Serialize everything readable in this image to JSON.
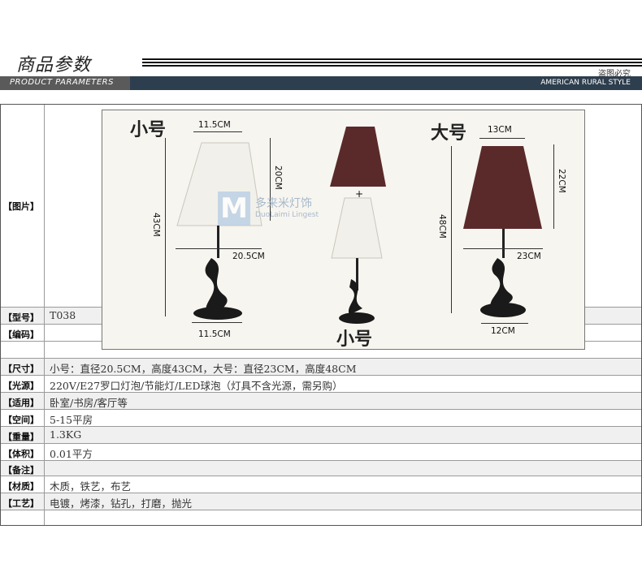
{
  "header": {
    "title": "商品参数",
    "subtitle": "PRODUCT PARAMETERS",
    "right_top": "盗图必究",
    "right_bottom": "AMERICAN RURAL STYLE"
  },
  "photo": {
    "label_small_left": "小号",
    "label_large": "大号",
    "label_small_bottom": "小号",
    "plus": "+",
    "watermark_cn": "多来米灯饰",
    "watermark_en": "DuoLaimi Lingest",
    "watermark_logo": "M",
    "small_lamp": {
      "top_width": "11.5CM",
      "shade_height": "20CM",
      "total_height": "43CM",
      "shade_diameter": "20.5CM",
      "base_width": "11.5CM"
    },
    "large_lamp": {
      "top_width": "13CM",
      "shade_height": "22CM",
      "total_height": "48CM",
      "shade_diameter": "23CM",
      "base_width": "12CM"
    }
  },
  "rows": [
    {
      "label": "【图片】",
      "value": ""
    },
    {
      "label": "【型号】",
      "value": "T038"
    },
    {
      "label": "【编码】",
      "value": ""
    },
    {
      "label": "【尺寸】",
      "value": "小号：直径20.5CM，高度43CM，大号：直径23CM，高度48CM"
    },
    {
      "label": "【光源】",
      "value": "220V/E27罗口灯泡/节能灯/LED球泡（灯具不含光源，需另购）"
    },
    {
      "label": "【适用】",
      "value": "卧室/书房/客厅等"
    },
    {
      "label": "【空间】",
      "value": "5-15平房"
    },
    {
      "label": "【重量】",
      "value": "1.3KG"
    },
    {
      "label": "【体积】",
      "value": "0.01平方"
    },
    {
      "label": "【备注】",
      "value": ""
    },
    {
      "label": "【材质】",
      "value": "木质，铁艺，布艺"
    },
    {
      "label": "【工艺】",
      "value": "电镀，烤漆，钻孔，打磨，抛光"
    }
  ],
  "colors": {
    "brown_shade": "#5a2a2a",
    "white_shade": "#f2f0ea",
    "band": "#2d3e4e",
    "base": "#1a1a1a"
  }
}
